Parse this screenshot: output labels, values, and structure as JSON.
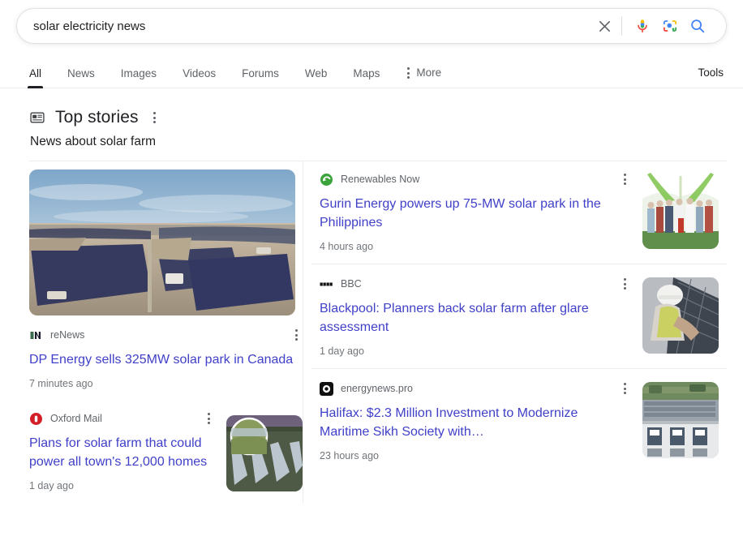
{
  "search": {
    "query": "solar electricity news",
    "placeholder": "Search",
    "clear_icon": "close-icon",
    "mic_icon": "microphone-icon",
    "lens_icon": "google-lens-icon",
    "search_icon": "search-icon"
  },
  "nav": {
    "tabs": [
      {
        "label": "All",
        "active": true
      },
      {
        "label": "News",
        "active": false
      },
      {
        "label": "Images",
        "active": false
      },
      {
        "label": "Videos",
        "active": false
      },
      {
        "label": "Forums",
        "active": false
      },
      {
        "label": "Web",
        "active": false
      },
      {
        "label": "Maps",
        "active": false
      }
    ],
    "more_label": "More",
    "tools_label": "Tools"
  },
  "top_stories": {
    "title": "Top stories",
    "subtitle": "News about solar farm",
    "icon": "newspaper-icon"
  },
  "stories": {
    "hero": {
      "source": "reNews",
      "headline": "DP Energy sells 325MW solar park in Canada",
      "timestamp": "7 minutes ago",
      "image_alt": "aerial-solar-farm-photo"
    },
    "left": [
      {
        "source": "Oxford Mail",
        "headline": "Plans for solar farm that could power all town's 12,000 homes",
        "timestamp": "1 day ago",
        "image_alt": "solar-panel-rows-thumbnail"
      }
    ],
    "right": [
      {
        "source": "Renewables Now",
        "headline": "Gurin Energy powers up 75-MW solar park in the Philippines",
        "timestamp": "4 hours ago",
        "image_alt": "ceremony-group-photo-thumbnail"
      },
      {
        "source": "BBC",
        "headline": "Blackpool: Planners back solar farm after glare assessment",
        "timestamp": "1 day ago",
        "image_alt": "worker-installing-solar-panel-thumbnail"
      },
      {
        "source": "energynews.pro",
        "headline": "Halifax: $2.3 Million Investment to Modernize Maritime Sikh Society with…",
        "timestamp": "23 hours ago",
        "image_alt": "rooftop-solar-panels-thumbnail"
      }
    ]
  },
  "colors": {
    "link": "#4040c8",
    "text": "#202124",
    "muted": "#70757a",
    "google_blue": "#4285f4",
    "google_red": "#ea4335",
    "google_yellow": "#fbbc05",
    "google_green": "#34a853",
    "oxford_mail_red": "#d32028",
    "renewables_green": "#3aa43a"
  }
}
